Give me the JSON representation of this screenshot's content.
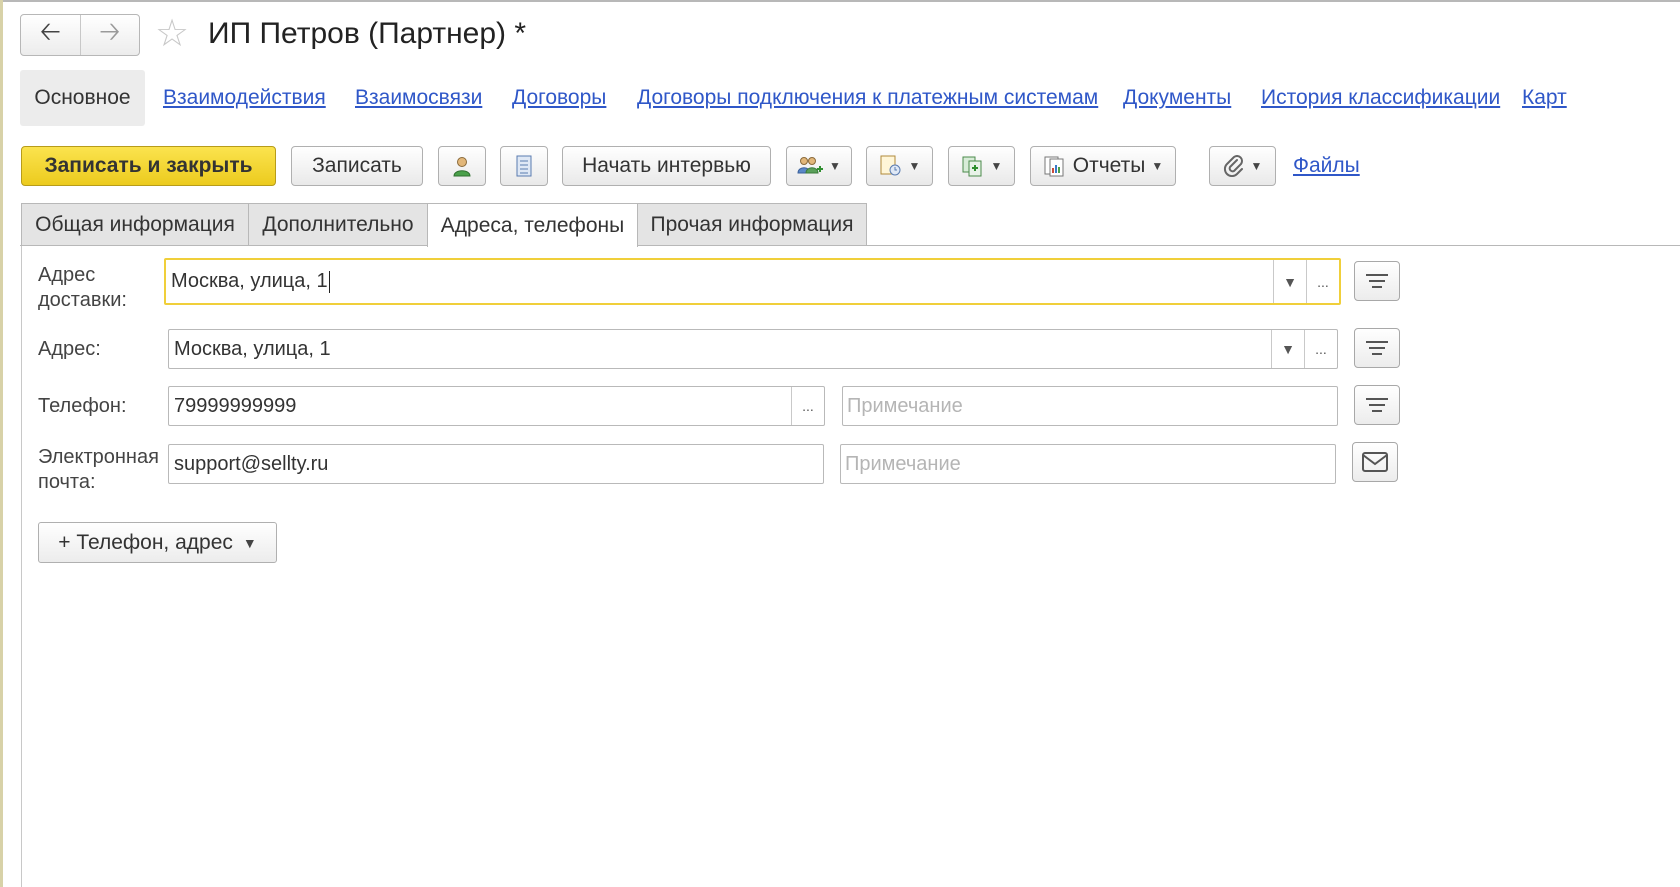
{
  "window": {
    "title": "ИП Петров (Партнер) *"
  },
  "sections": {
    "active": "Основное",
    "links": [
      "Взаимодействия",
      "Взаимосвязи",
      "Договоры",
      "Договоры подключения к платежным системам",
      "Документы",
      "История классификации",
      "Карт"
    ]
  },
  "toolbar": {
    "save_close": "Записать и закрыть",
    "save": "Записать",
    "start_interview": "Начать интервью",
    "reports": "Отчеты",
    "files": "Файлы"
  },
  "tabs": [
    "Общая информация",
    "Дополнительно",
    "Адреса, телефоны",
    "Прочая информация"
  ],
  "form": {
    "delivery_address": {
      "label_line1": "Адрес",
      "label_line2": "доставки:",
      "value": "Москва, улица, 1"
    },
    "address": {
      "label": "Адрес:",
      "value": "Москва, улица, 1"
    },
    "phone": {
      "label": "Телефон:",
      "value": "79999999999",
      "note_placeholder": "Примечание"
    },
    "email": {
      "label_line1": "Электронная",
      "label_line2": "почта:",
      "value": "support@sellty.ru",
      "note_placeholder": "Примечание"
    },
    "add_button": "+ Телефон, адрес"
  },
  "colors": {
    "accent_yellow": "#f2d230",
    "link_blue": "#2f57c8",
    "focus_border": "#f0cf3a"
  }
}
